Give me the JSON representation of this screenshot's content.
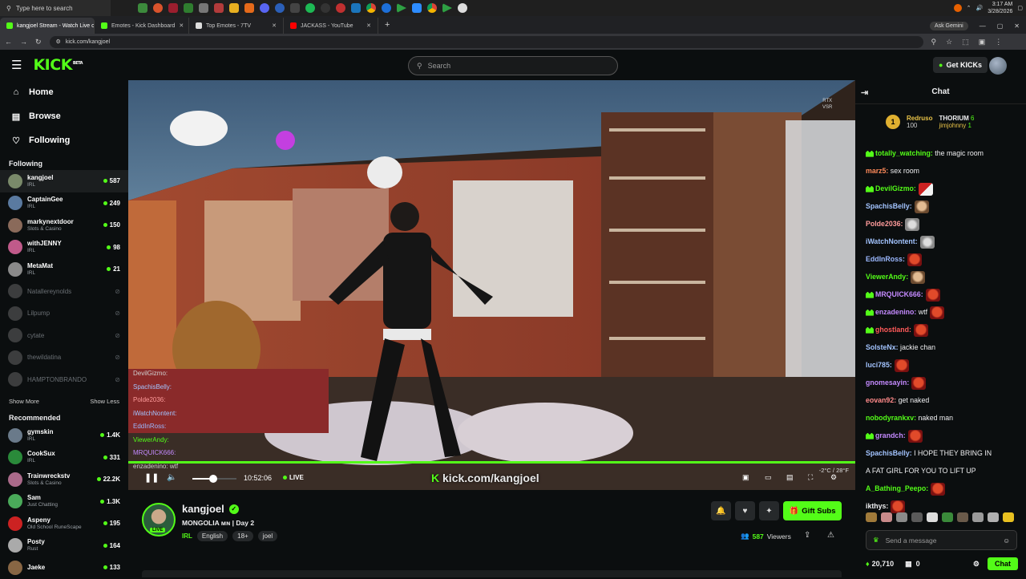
{
  "taskbar": {
    "search_placeholder": "Type here to search",
    "time": "3:17 AM",
    "date": "3/28/2026"
  },
  "browser": {
    "tabs": [
      {
        "label": "kangjoel Stream - Watch Live o",
        "color": "#53fc18",
        "active": true
      },
      {
        "label": "Emotes - Kick Dashboard",
        "color": "#53fc18",
        "active": false
      },
      {
        "label": "Top Emotes - 7TV",
        "color": "#dddddd",
        "active": false
      },
      {
        "label": "JACKASS - YouTube",
        "color": "#ff0000",
        "active": false
      }
    ],
    "ask_gemini": "Ask Gemini",
    "url": "kick.com/kangjoel"
  },
  "header": {
    "logo": "KICK",
    "logo_sup": "BETA",
    "search_placeholder": "Search",
    "get_kicks": "Get KICKs"
  },
  "sidebar": {
    "nav": [
      {
        "label": "Home",
        "icon": "home-icon",
        "glyph": "⌂"
      },
      {
        "label": "Browse",
        "icon": "browse-icon",
        "glyph": "▤"
      },
      {
        "label": "Following",
        "icon": "heart-icon",
        "glyph": "♡"
      }
    ],
    "following_title": "Following",
    "following": [
      {
        "name": "kangjoel",
        "category": "IRL",
        "viewers": "587",
        "live": true,
        "color": "#7a8a6a"
      },
      {
        "name": "CaptainGee",
        "category": "IRL",
        "viewers": "249",
        "live": true,
        "color": "#5a7aa0"
      },
      {
        "name": "markynextdoor",
        "category": "Slots & Casino",
        "viewers": "150",
        "live": true,
        "color": "#8a6a5a"
      },
      {
        "name": "withJENNY",
        "category": "IRL",
        "viewers": "98",
        "live": true,
        "color": "#c05a8a"
      },
      {
        "name": "MetaMat",
        "category": "IRL",
        "viewers": "21",
        "live": true,
        "color": "#8a8a8a"
      },
      {
        "name": "Natallereynolds",
        "category": "",
        "viewers": "",
        "live": false,
        "color": "#777777"
      },
      {
        "name": "Lilpump",
        "category": "",
        "viewers": "",
        "live": false,
        "color": "#777777"
      },
      {
        "name": "cytate",
        "category": "",
        "viewers": "",
        "live": false,
        "color": "#777777"
      },
      {
        "name": "thewildatina",
        "category": "",
        "viewers": "",
        "live": false,
        "color": "#777777"
      },
      {
        "name": "HAMPTONBRANDO",
        "category": "",
        "viewers": "",
        "live": false,
        "color": "#777777"
      }
    ],
    "show_more": "Show More",
    "show_less": "Show Less",
    "recommended_title": "Recommended",
    "recommended": [
      {
        "name": "gymskin",
        "category": "IRL",
        "viewers": "1.4K",
        "color": "#6a7a8a"
      },
      {
        "name": "CookSux",
        "category": "IRL",
        "viewers": "331",
        "color": "#2a8a3a"
      },
      {
        "name": "Trainwreckstv",
        "category": "Slots & Casino",
        "viewers": "22.2K",
        "color": "#aa6a8a"
      },
      {
        "name": "Sam",
        "category": "Just Chatting",
        "viewers": "1.3K",
        "color": "#4aaa5a"
      },
      {
        "name": "Aspeny",
        "category": "Old School RuneScape",
        "viewers": "195",
        "color": "#cc2222"
      },
      {
        "name": "Posty",
        "category": "Rust",
        "viewers": "164",
        "color": "#aaaaaa"
      },
      {
        "name": "Jaeke",
        "category": "",
        "viewers": "133",
        "color": "#886644"
      }
    ]
  },
  "video": {
    "overlay_chat": [
      {
        "name": "DevilGizmo:",
        "color": "#cfcfcf"
      },
      {
        "name": "SpachisBelly:",
        "color": "#a3c4ff"
      },
      {
        "name": "Polde2036:",
        "color": "#ff9b9b"
      },
      {
        "name": "iWatchNontent:",
        "color": "#a3c4ff"
      },
      {
        "name": "EddInRoss:",
        "color": "#9bb8ff"
      },
      {
        "name": "ViewerAndy:",
        "color": "#53fc18"
      },
      {
        "name": "MRQUICK666:",
        "color": "#c48aff"
      },
      {
        "name": "enzadenino: wtf",
        "color": "#cfcfcf"
      }
    ],
    "time": "10:52:06",
    "live_label": "LIVE",
    "watermark": "kick.com/kangjoel",
    "temperature": "-2°C / 28°F",
    "rtx": "RTX",
    "vsr": "VSR",
    "volume_level": 0.47
  },
  "stream": {
    "name": "kangjoel",
    "live_badge": "LIVE",
    "title": "MONGOLIA ᴍɴ | Day 2",
    "category": "IRL",
    "tags": [
      "English",
      "18+",
      "joel"
    ],
    "viewers": "587",
    "viewers_label": "Viewers",
    "gift_subs": "Gift Subs"
  },
  "chat": {
    "title": "Chat",
    "pinned": {
      "rank": "1",
      "leader": "Redruso",
      "leader_count": "100",
      "second": "THORIUM",
      "second_count": "6",
      "third": "jimjohnny",
      "third_count": "1"
    },
    "messages": [
      {
        "user": "totally_watching:",
        "color": "#53fc18",
        "text": " the magic room",
        "badge": true,
        "emote": ""
      },
      {
        "user": "marz5:",
        "color": "#ff8a5a",
        "text": " sex room",
        "badge": false,
        "emote": ""
      },
      {
        "user": "DevilGizmo:",
        "color": "#53fc18",
        "text": "",
        "badge": true,
        "emote": "em-pink"
      },
      {
        "user": "SpachisBelly:",
        "color": "#a3c4ff",
        "text": "",
        "badge": false,
        "emote": "em-face"
      },
      {
        "user": "Polde2036:",
        "color": "#ff9b9b",
        "text": "",
        "badge": false,
        "emote": "em-cat"
      },
      {
        "user": "iWatchNontent:",
        "color": "#a3c4ff",
        "text": "",
        "badge": false,
        "emote": "em-cat"
      },
      {
        "user": "EddInRoss:",
        "color": "#9bb8ff",
        "text": "",
        "badge": false,
        "emote": "em-red"
      },
      {
        "user": "ViewerAndy:",
        "color": "#53fc18",
        "text": "",
        "badge": false,
        "emote": "em-face"
      },
      {
        "user": "MRQUICK666:",
        "color": "#c48aff",
        "text": "",
        "badge": true,
        "emote": "em-red"
      },
      {
        "user": "enzadenino:",
        "color": "#c48aff",
        "text": " wtf",
        "badge": true,
        "emote": "em-red"
      },
      {
        "user": "ghostland:",
        "color": "#ff5a5a",
        "text": "",
        "badge": true,
        "emote": "em-red"
      },
      {
        "user": "SolsteNx:",
        "color": "#a3c4ff",
        "text": " jackie chan",
        "badge": false,
        "emote": ""
      },
      {
        "user": "luci785:",
        "color": "#a3c4ff",
        "text": "",
        "badge": false,
        "emote": "em-red"
      },
      {
        "user": "gnomesayin:",
        "color": "#c48aff",
        "text": "",
        "badge": false,
        "emote": "em-red"
      },
      {
        "user": "eovan92:",
        "color": "#ff8a8a",
        "text": " get naked",
        "badge": false,
        "emote": ""
      },
      {
        "user": "nobodyrankxv:",
        "color": "#53fc18",
        "text": " naked man",
        "badge": false,
        "emote": ""
      },
      {
        "user": "grandch:",
        "color": "#c48aff",
        "text": "",
        "badge": true,
        "emote": "em-red"
      },
      {
        "user": "SpachisBelly:",
        "color": "#a3c4ff",
        "text": " I HOPE THEY BRING IN",
        "badge": false,
        "emote": ""
      },
      {
        "user": "",
        "color": "#efeff1",
        "text": "A FAT GIRL FOR YOU TO LIFT UP",
        "badge": false,
        "emote": ""
      },
      {
        "user": "A_Bathing_Peepo:",
        "color": "#53fc18",
        "text": "",
        "badge": false,
        "emote": "em-red"
      },
      {
        "user": "ikthys:",
        "color": "#efeff1",
        "text": "",
        "badge": false,
        "emote": "em-red"
      }
    ],
    "input_placeholder": "Send a message",
    "kicks_count": "20,710",
    "second_count": "0",
    "chat_button": "Chat"
  }
}
